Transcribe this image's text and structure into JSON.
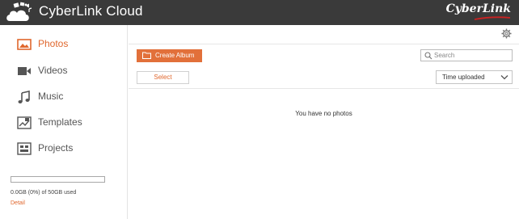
{
  "app": {
    "title": "CyberLink Cloud",
    "brand": "CyberLink"
  },
  "sidebar": {
    "items": [
      {
        "label": "Photos",
        "icon": "photo-icon",
        "active": true
      },
      {
        "label": "Videos",
        "icon": "video-camera-icon",
        "active": false
      },
      {
        "label": "Music",
        "icon": "music-note-icon",
        "active": false
      },
      {
        "label": "Templates",
        "icon": "templates-icon",
        "active": false
      },
      {
        "label": "Projects",
        "icon": "projects-icon",
        "active": false
      }
    ],
    "storage": {
      "used_fraction": 0,
      "text": "0.0GB (0%) of 50GB used",
      "detail_label": "Detail"
    }
  },
  "toolbar": {
    "create_album_label": "Create Album",
    "search_placeholder": "Search",
    "select_label": "Select",
    "sort_value": "Time uploaded"
  },
  "main": {
    "empty_message": "You have no photos"
  },
  "colors": {
    "accent": "#e0672d",
    "topbar": "#3a3a3a"
  }
}
